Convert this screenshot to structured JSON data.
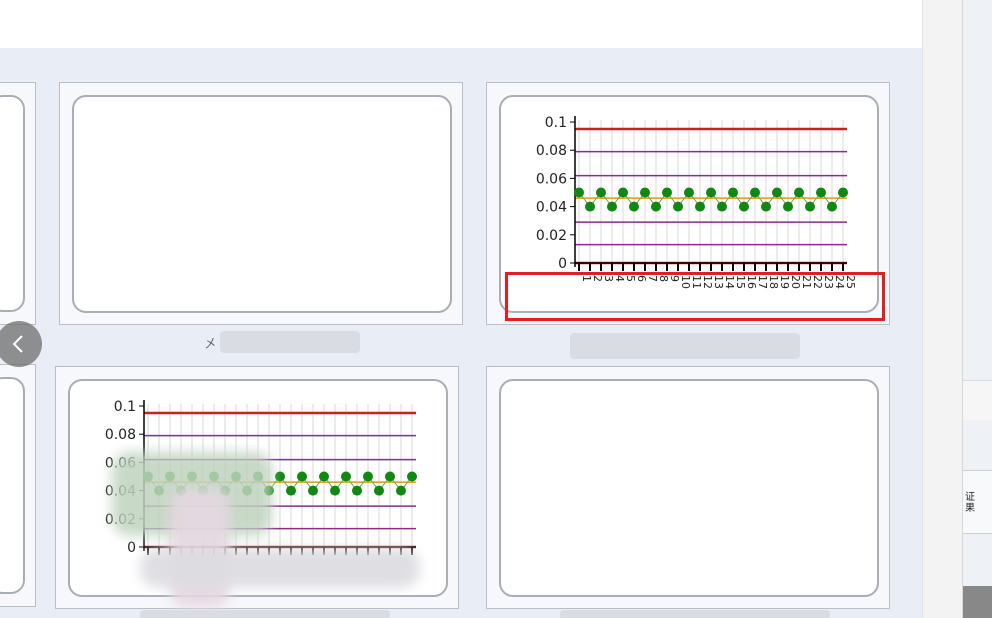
{
  "gallery": {
    "prev_label": "‹",
    "cards": [
      {
        "id": "a",
        "caption": "",
        "has_chart": false
      },
      {
        "id": "b",
        "caption": "",
        "has_chart": true,
        "x_labels_visible": true
      },
      {
        "id": "c",
        "caption": "",
        "has_chart": true,
        "x_labels_visible": false
      },
      {
        "id": "d",
        "caption": "",
        "has_chart": false
      }
    ]
  },
  "right_panel": {
    "header_text": "证\n果"
  },
  "chart_data": [
    {
      "type": "line",
      "yticks": [
        "0.1",
        "0.08",
        "0.06",
        "0.04",
        "0.02",
        "0"
      ],
      "ylim": [
        0,
        0.1
      ],
      "x": [
        "1",
        "2",
        "3",
        "4",
        "5",
        "6",
        "7",
        "8",
        "9",
        "10",
        "11",
        "12",
        "13",
        "14",
        "15",
        "16",
        "17",
        "18",
        "19",
        "20",
        "21",
        "22",
        "23",
        "24",
        "25"
      ],
      "control_lines": [
        {
          "name": "",
          "value": 0.095,
          "color": "#cc2020"
        },
        {
          "name": "",
          "value": 0.079,
          "color": "#8a2a8a"
        },
        {
          "name": "",
          "value": 0.062,
          "color": "#8a2a8a"
        },
        {
          "name": "",
          "value": 0.046,
          "color": "#e69a00"
        },
        {
          "name": "",
          "value": 0.029,
          "color": "#8a2a8a"
        },
        {
          "name": "",
          "value": 0.013,
          "color": "#8a2a8a"
        },
        {
          "name": "",
          "value": 0.0,
          "color": "#cc2020"
        }
      ],
      "series": [
        {
          "name": "",
          "color": "#118811",
          "values": [
            0.05,
            0.04,
            0.05,
            0.04,
            0.05,
            0.04,
            0.05,
            0.04,
            0.05,
            0.04,
            0.05,
            0.04,
            0.05,
            0.04,
            0.05,
            0.04,
            0.05,
            0.04,
            0.05,
            0.04,
            0.05,
            0.04,
            0.05,
            0.04,
            0.05
          ]
        }
      ]
    }
  ]
}
